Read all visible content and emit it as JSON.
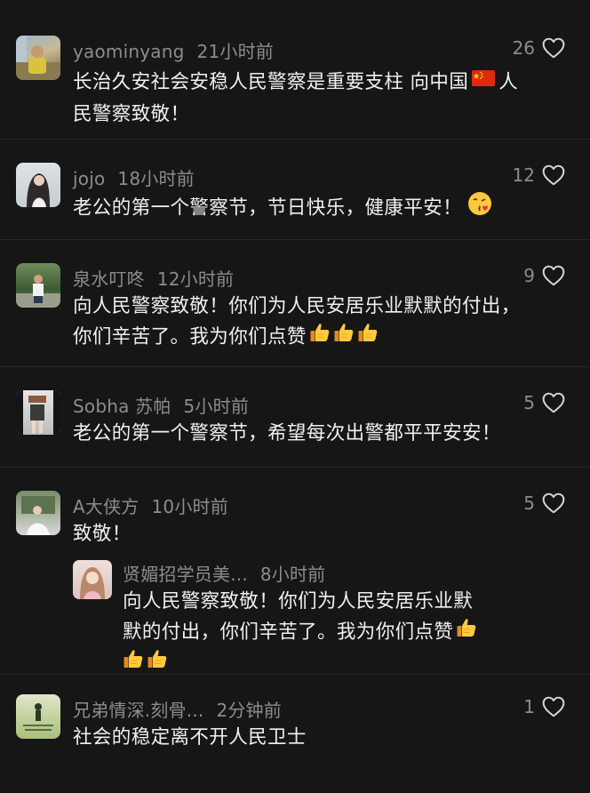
{
  "comments": [
    {
      "username": "yaominyang",
      "time": "21小时前",
      "likes": "26",
      "text_line1": "长治久安社会安稳人民警察是重要支柱 向中国",
      "text_after_flag": "人",
      "text_line2": "民警察致敬！",
      "emoji": "china-flag"
    },
    {
      "username": "jojo",
      "time": "18小时前",
      "likes": "12",
      "text_line1": "老公的第一个警察节，节日快乐，健康平安！",
      "emoji": "kiss-face"
    },
    {
      "username": "泉水叮咚",
      "time": "12小时前",
      "likes": "9",
      "text_line1": "向人民警察致敬！你们为人民安居乐业默默的付出，",
      "text_line2": "你们辛苦了。我为你们点赞",
      "emoji": "thumbs-up"
    },
    {
      "username": "Sobha 苏帕",
      "time": "5小时前",
      "likes": "5",
      "text_line1": "老公的第一个警察节，希望每次出警都平平安安！"
    },
    {
      "username": "A大侠方",
      "time": "10小时前",
      "likes": "5",
      "text_line1": "致敬！",
      "reply": {
        "username": "贤媚招学员美...",
        "time": "8小时前",
        "text_line1": "向人民警察致敬！你们为人民安居乐业默",
        "text_line2": "默的付出，你们辛苦了。我为你们点赞",
        "emoji": "thumbs-up"
      }
    },
    {
      "username": "兄弟情深.刻骨...",
      "time": "2分钟前",
      "likes": "1",
      "text_line1": "社会的稳定离不开人民卫士"
    }
  ]
}
